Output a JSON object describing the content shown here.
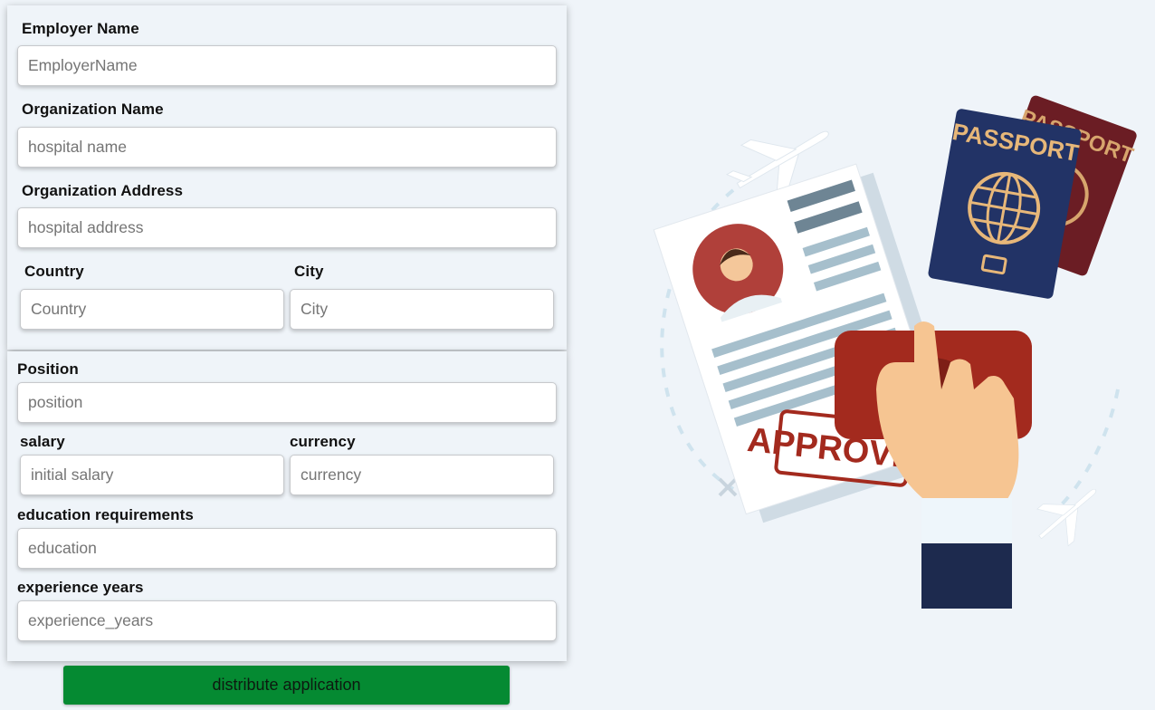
{
  "form": {
    "employer_name": {
      "label": "Employer Name",
      "placeholder": "EmployerName"
    },
    "organization_name": {
      "label": "Organization Name",
      "placeholder": "hospital name"
    },
    "organization_address": {
      "label": "Organization Address",
      "placeholder": "hospital address"
    },
    "country": {
      "label": "Country",
      "placeholder": "Country"
    },
    "city": {
      "label": "City",
      "placeholder": "City"
    },
    "position": {
      "label": "Position",
      "placeholder": "position"
    },
    "salary": {
      "label": "salary",
      "placeholder": "initial salary"
    },
    "currency": {
      "label": "currency",
      "placeholder": "currency"
    },
    "education": {
      "label": "education requirements",
      "placeholder": "education"
    },
    "experience": {
      "label": "experience years",
      "placeholder": "experience_years"
    },
    "submit_label": "distribute application"
  },
  "illustration": {
    "passport_front_text": "PASSPORT",
    "passport_back_text": "PASSPORT",
    "stamp_text": "APPROVED"
  },
  "colors": {
    "background": "#eff4f9",
    "button": "#058a32",
    "passport_front": "#223366",
    "passport_back": "#6b1d24",
    "stamp": "#a32a1e"
  }
}
